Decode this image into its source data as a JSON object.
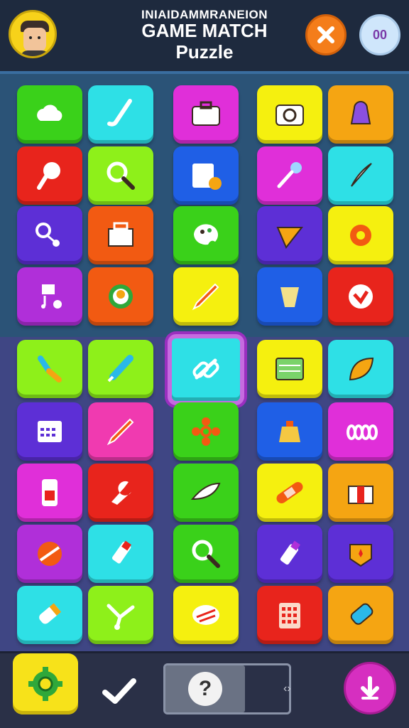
{
  "header": {
    "title_top": "INIAIDAMMRANEION",
    "title_main": "GAME MATCH",
    "title_sub": "Puzzle",
    "pause_label": "00"
  },
  "colors": {
    "green": "#3ad11a",
    "cyan": "#2ee0e6",
    "magenta": "#e02fd9",
    "yellow": "#f5f00f",
    "orange": "#f5a512",
    "red": "#e8241c",
    "blue": "#1f5fe6",
    "purple": "#5d2fd6",
    "lime": "#8ef01a",
    "deeporange": "#f25a12",
    "violet": "#b02fd9",
    "pink": "#f03ab0"
  },
  "tiles": [
    {
      "icon": "cloud-icon",
      "color": "green"
    },
    {
      "icon": "hockey-stick-icon",
      "color": "cyan"
    },
    {
      "icon": "briefcase-icon",
      "color": "magenta"
    },
    {
      "icon": "camera-icon",
      "color": "yellow"
    },
    {
      "icon": "bell-icon",
      "color": "orange"
    },
    {
      "icon": "ice-cream-icon",
      "color": "red"
    },
    {
      "icon": "magnifier-icon",
      "color": "lime"
    },
    {
      "icon": "calendar-clock-icon",
      "color": "blue"
    },
    {
      "icon": "pin-icon",
      "color": "magenta"
    },
    {
      "icon": "feather-icon",
      "color": "cyan"
    },
    {
      "icon": "scissors-icon",
      "color": "purple"
    },
    {
      "icon": "basket-icon",
      "color": "deeporange"
    },
    {
      "icon": "palette-icon",
      "color": "green"
    },
    {
      "icon": "cone-icon",
      "color": "purple"
    },
    {
      "icon": "gear-icon",
      "color": "yellow"
    },
    {
      "icon": "music-note-icon",
      "color": "violet"
    },
    {
      "icon": "salad-bowl-icon",
      "color": "deeporange"
    },
    {
      "icon": "pencil-icon",
      "color": "yellow"
    },
    {
      "icon": "cup-icon",
      "color": "blue"
    },
    {
      "icon": "heart-icon",
      "color": "red"
    },
    {
      "icon": "brush-icon",
      "color": "lime"
    },
    {
      "icon": "marker-icon",
      "color": "lime"
    },
    {
      "icon": "chain-link-icon",
      "color": "cyan",
      "selected": true
    },
    {
      "icon": "board-icon",
      "color": "yellow"
    },
    {
      "icon": "leaf-icon",
      "color": "cyan"
    },
    {
      "icon": "calendar-icon",
      "color": "purple"
    },
    {
      "icon": "pencil-icon",
      "color": "pink"
    },
    {
      "icon": "flower-icon",
      "color": "green"
    },
    {
      "icon": "bag-icon",
      "color": "blue"
    },
    {
      "icon": "spring-icon",
      "color": "magenta"
    },
    {
      "icon": "phone-icon",
      "color": "magenta"
    },
    {
      "icon": "wrench-icon",
      "color": "red"
    },
    {
      "icon": "fish-icon",
      "color": "green"
    },
    {
      "icon": "bandage-icon",
      "color": "yellow"
    },
    {
      "icon": "box-icon",
      "color": "orange"
    },
    {
      "icon": "ball-icon",
      "color": "violet"
    },
    {
      "icon": "tube-icon",
      "color": "cyan"
    },
    {
      "icon": "magnifier-icon",
      "color": "green"
    },
    {
      "icon": "lipstick-icon",
      "color": "purple"
    },
    {
      "icon": "badge-icon",
      "color": "purple"
    },
    {
      "icon": "roll-icon",
      "color": "cyan"
    },
    {
      "icon": "branch-icon",
      "color": "lime"
    },
    {
      "icon": "pie-icon",
      "color": "yellow"
    },
    {
      "icon": "calculator-icon",
      "color": "red"
    },
    {
      "icon": "bottle-icon",
      "color": "orange"
    }
  ],
  "footer": {
    "hint_label": "?",
    "arrow_label": "‹›"
  }
}
